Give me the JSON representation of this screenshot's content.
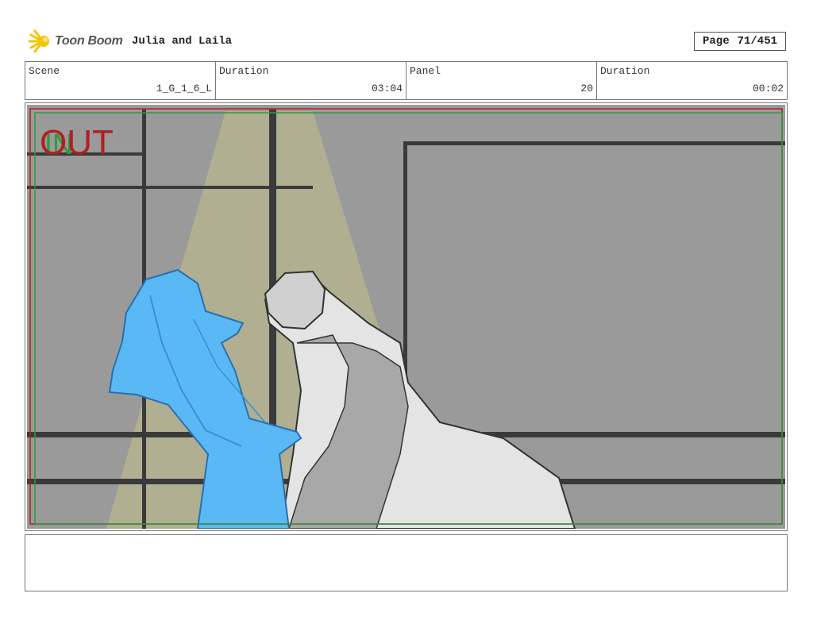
{
  "header": {
    "brand_name": "Toon Boom",
    "logo_icon": "starburst-icon",
    "project_title": "Julia and Laila",
    "page_label": "Page",
    "page_number": "71/451"
  },
  "info_row": [
    {
      "label": "Scene",
      "value": "1_G_1_6_L"
    },
    {
      "label": "Duration",
      "value": "03:04"
    },
    {
      "label": "Panel",
      "value": "20"
    },
    {
      "label": "Duration",
      "value": "00:02"
    }
  ],
  "panel": {
    "in_marker": "IN",
    "out_marker": "OUT",
    "colors": {
      "wall": "#9a9a9a",
      "spotlight": "#b4b38f",
      "frame_lines": "#3a3a3a",
      "figure_blue": "#5ab9f5",
      "figure_white": "#e4e4e4",
      "safe_area_red": "#b02020",
      "safe_area_green": "#2f9a3f"
    }
  },
  "notes": {
    "text": ""
  }
}
